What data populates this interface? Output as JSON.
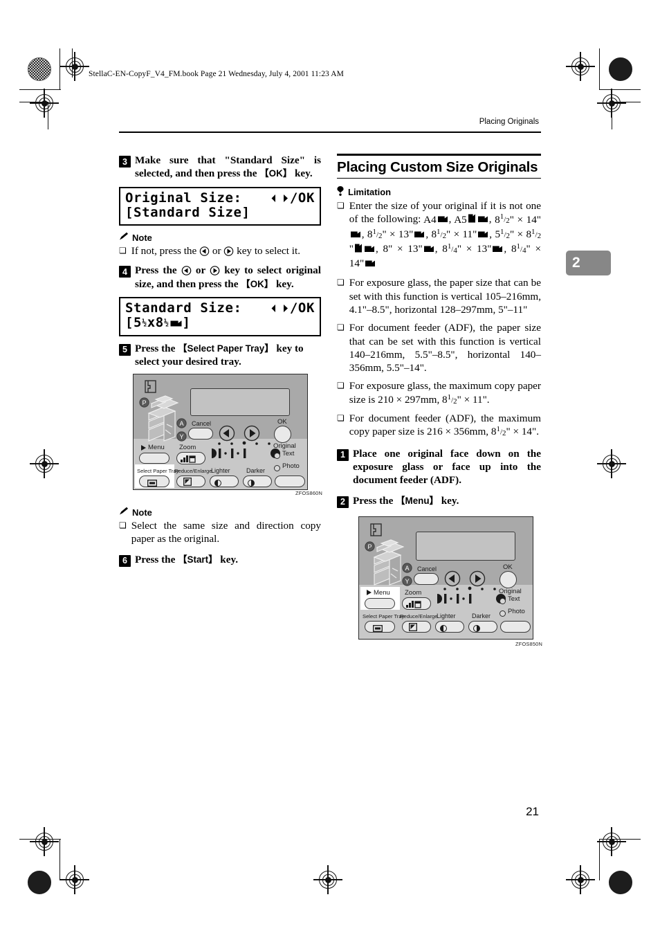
{
  "document": {
    "file_header": "StellaC-EN-CopyF_V4_FM.book  Page 21  Wednesday, July 4, 2001  11:23 AM",
    "running_head": "Placing Originals",
    "chapter_tab": "2",
    "page_number": "21"
  },
  "left_column": {
    "step3": {
      "number": "3",
      "text_before": "Make sure that \"Standard Size\" is selected, and then press the ",
      "key": "OK",
      "text_after": " key."
    },
    "lcd1": {
      "line1_label": "Original Size:",
      "line1_right": "/OK",
      "line2": "[Standard Size]"
    },
    "note1": {
      "heading": "Note",
      "text_before": "If not, press the ",
      "text_mid": " or ",
      "text_after": " key to select it."
    },
    "step4": {
      "number": "4",
      "text_before": "Press the ",
      "text_mid": " or ",
      "text_mid2": " key to select original size, and then press the ",
      "key": "OK",
      "text_after": " key."
    },
    "lcd2": {
      "line1_label": "Standard Size:",
      "line1_right": "/OK",
      "line2_open": "[5",
      "line2_frac1": "1/2",
      "line2_mid": "x8",
      "line2_frac2": "1/2",
      "line2_close": "]"
    },
    "step5": {
      "number": "5",
      "text_before": "Press the ",
      "key": "Select Paper Tray",
      "text_after": " key to select your desired tray."
    },
    "figure1": {
      "caption": "ZFOS860N",
      "highlighted_key": "Select Paper Tray",
      "labels": {
        "cancel": "Cancel",
        "ok": "OK",
        "menu": "Menu",
        "zoom": "Zoom",
        "select_paper_tray": "Select Paper Tray",
        "reduce_enlarge": "Reduce/Enlarge",
        "lighter": "Lighter",
        "darker": "Darker",
        "original": "Original",
        "text": "Text",
        "photo": "Photo",
        "callout_p": "P",
        "callout_a": "A",
        "callout_y": "Y"
      }
    },
    "note2": {
      "heading": "Note",
      "text": "Select the same size and direction copy paper as the original."
    },
    "step6": {
      "number": "6",
      "text_before": "Press the ",
      "key": "Start",
      "text_after": " key."
    }
  },
  "right_column": {
    "section_title": "Placing Custom Size Originals",
    "limitation_heading": "Limitation",
    "limitations": [
      {
        "id": "sizes",
        "lead": "Enter the size of your original if it is not one of the following: ",
        "sizes": [
          {
            "name": "A4",
            "orient": [
              "land"
            ]
          },
          {
            "name": "A5",
            "orient": [
              "port",
              "land"
            ]
          },
          {
            "name": "8<FRAC1_2>\" × 14\"",
            "orient": [
              "land"
            ]
          },
          {
            "name": "8<FRAC1_2>\" × 13\"",
            "orient": [
              "land"
            ]
          },
          {
            "name": "8<FRAC1_2>\" × 11\"",
            "orient": [
              "land"
            ]
          },
          {
            "name": "5<FRAC1_2>\" × 8<FRAC1_2>\"",
            "orient": [
              "port",
              "land"
            ]
          },
          {
            "name": "8\" × 13\"",
            "orient": [
              "land"
            ]
          },
          {
            "name": "8<FRAC1_4>\" × 13\"",
            "orient": [
              "land"
            ]
          },
          {
            "name": "8<FRAC1_4>\" × 14\"",
            "orient": [
              "land"
            ]
          }
        ]
      },
      {
        "id": "exposure-glass-range",
        "text": "For exposure glass, the paper size that can be set with this function is vertical 105–216mm, 4.1\"–8.5\", horizontal 128–297mm, 5\"–11\""
      },
      {
        "id": "adf-range",
        "text": "For document feeder (ADF), the paper size that can be set with this function is vertical 140–216mm, 5.5\"–8.5\", horizontal 140–356mm, 5.5\"–14\"."
      },
      {
        "id": "exposure-glass-max",
        "text_before": "For exposure glass, the maximum copy paper size is 210 × 297mm, 8",
        "frac": "1/2",
        "text_after": "\" × 11\"."
      },
      {
        "id": "adf-max",
        "text_before": "For document feeder (ADF), the maximum copy paper size is 216 × 356mm, 8",
        "frac": "1/2",
        "text_after": "\" × 14\"."
      }
    ],
    "step1": {
      "number": "1",
      "text": "Place one original face down on the exposure glass or face up into the document feeder (ADF)."
    },
    "step2": {
      "number": "2",
      "text_before": "Press the ",
      "key": "Menu",
      "text_after": " key."
    },
    "figure2": {
      "caption": "ZFOS850N",
      "highlighted_key": "Menu",
      "labels": {
        "cancel": "Cancel",
        "ok": "OK",
        "menu": "Menu",
        "zoom": "Zoom",
        "select_paper_tray": "Select Paper Tray",
        "reduce_enlarge": "Reduce/Enlarge",
        "lighter": "Lighter",
        "darker": "Darker",
        "original": "Original",
        "text": "Text",
        "photo": "Photo",
        "callout_p": "P",
        "callout_a": "A",
        "callout_y": "Y"
      }
    }
  }
}
